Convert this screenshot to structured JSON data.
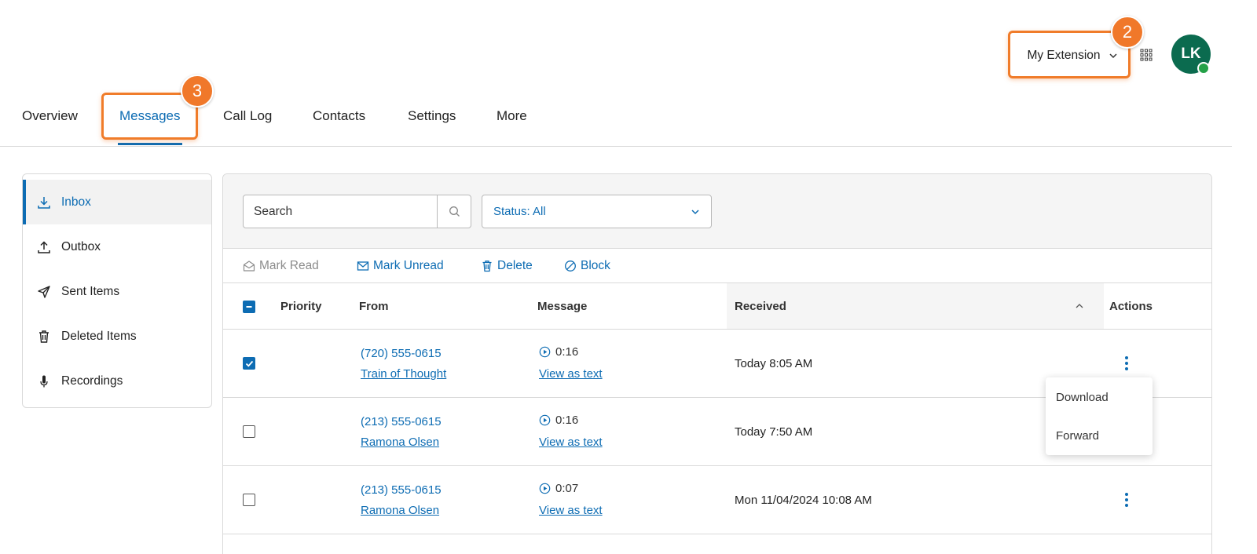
{
  "header": {
    "extension_label": "My Extension",
    "avatar_initials": "LK",
    "callout_extension": "2",
    "callout_messages": "3"
  },
  "tabs": [
    {
      "label": "Overview"
    },
    {
      "label": "Messages",
      "active": true
    },
    {
      "label": "Call Log"
    },
    {
      "label": "Contacts"
    },
    {
      "label": "Settings"
    },
    {
      "label": "More"
    }
  ],
  "sidebar": {
    "items": [
      {
        "label": "Inbox",
        "icon": "inbox-icon",
        "active": true
      },
      {
        "label": "Outbox",
        "icon": "outbox-icon"
      },
      {
        "label": "Sent Items",
        "icon": "send-icon"
      },
      {
        "label": "Deleted Items",
        "icon": "trash-icon"
      },
      {
        "label": "Recordings",
        "icon": "microphone-icon"
      }
    ]
  },
  "filters": {
    "search_placeholder": "Search",
    "status_value": "Status: All"
  },
  "bulk_actions": {
    "mark_read": "Mark Read",
    "mark_unread": "Mark Unread",
    "delete": "Delete",
    "block": "Block"
  },
  "table": {
    "columns": {
      "priority": "Priority",
      "from": "From",
      "message": "Message",
      "received": "Received",
      "actions": "Actions"
    },
    "rows": [
      {
        "checked": true,
        "from_number": "(720) 555-0615",
        "from_name": "Train of Thought",
        "duration": "0:16",
        "view_text": "View as text",
        "received": "Today 8:05 AM"
      },
      {
        "checked": false,
        "from_number": "(213) 555-0615",
        "from_name": "Ramona Olsen",
        "duration": "0:16",
        "view_text": "View as text",
        "received": "Today 7:50 AM"
      },
      {
        "checked": false,
        "from_number": "(213) 555-0615",
        "from_name": "Ramona Olsen",
        "duration": "0:07",
        "view_text": "View as text",
        "received": "Mon 11/04/2024 10:08 AM"
      }
    ]
  },
  "row_menu": {
    "download": "Download",
    "forward": "Forward"
  },
  "colors": {
    "accent": "#0d6cb3",
    "callout": "#f07c2a",
    "avatar": "#0b6b4f",
    "presence": "#24a148"
  }
}
